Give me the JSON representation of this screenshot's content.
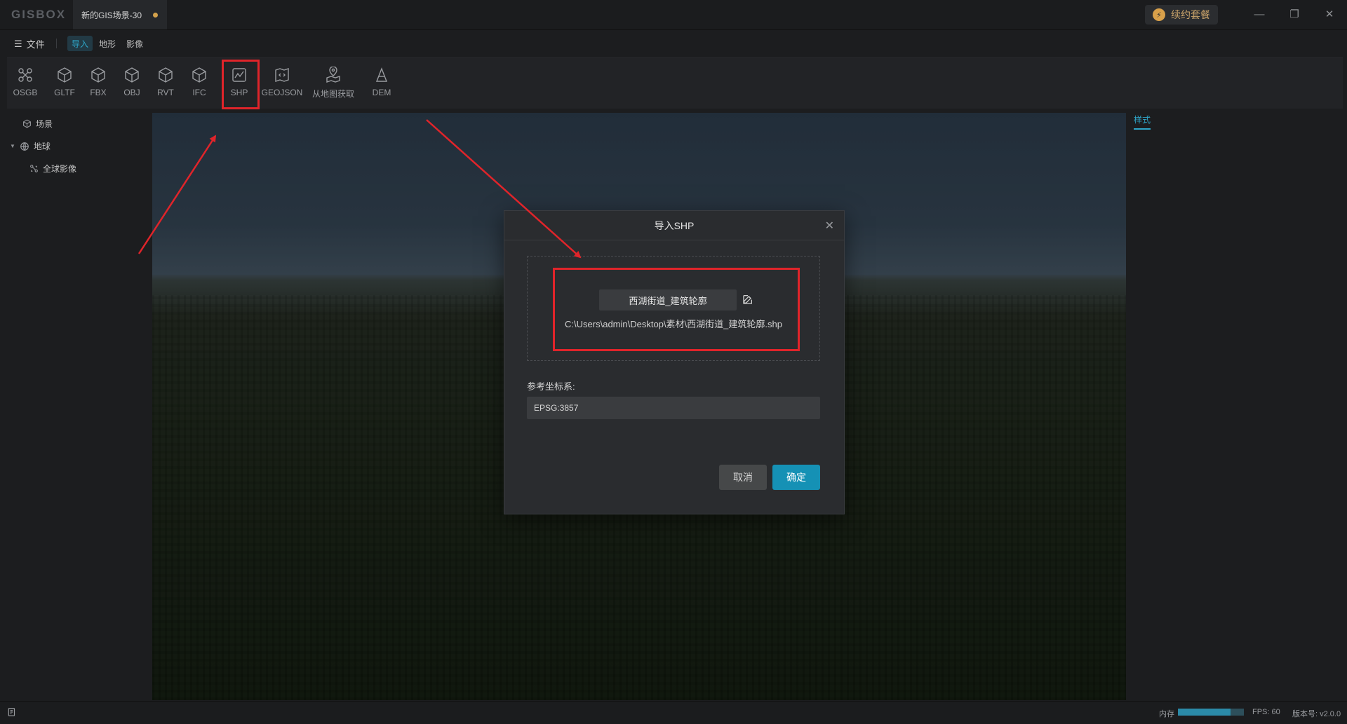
{
  "app": {
    "logo": "GISBOX",
    "document_tab": "新的GIS场景-30",
    "renew_label": "续约套餐"
  },
  "menu": {
    "file": "文件",
    "tabs": [
      "导入",
      "地形",
      "影像"
    ]
  },
  "toolbar": {
    "tools": [
      "OSGB",
      "GLTF",
      "FBX",
      "OBJ",
      "RVT",
      "IFC",
      "SHP",
      "GEOJSON",
      "从地图获取",
      "DEM"
    ]
  },
  "sidebar": {
    "items": [
      "场景",
      "地球",
      "全球影像"
    ]
  },
  "right_panel": {
    "tab": "样式"
  },
  "dialog": {
    "title": "导入SHP",
    "file_name": "西湖街道_建筑轮廓",
    "file_path": "C:\\Users\\admin\\Desktop\\素材\\西湖街道_建筑轮廓.shp",
    "crs_label": "参考坐标系:",
    "crs_value": "EPSG:3857",
    "cancel": "取消",
    "ok": "确定"
  },
  "status": {
    "memory_label": "内存",
    "memory_fraction": 0.8,
    "fps": "FPS: 60",
    "version": "版本号: v2.0.0"
  },
  "colors": {
    "accent": "#1591b5",
    "annotation_red": "#e0242a",
    "dirty_dot": "#d4a24c"
  }
}
